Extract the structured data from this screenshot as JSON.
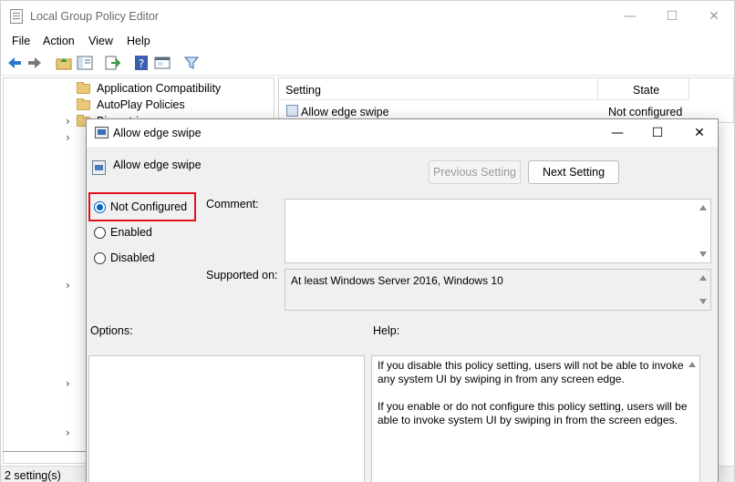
{
  "main_window": {
    "title": "Local Group Policy Editor",
    "controls": {
      "minimize": "—",
      "maximize": "☐",
      "close": "✕"
    }
  },
  "menu": [
    "File",
    "Action",
    "View",
    "Help"
  ],
  "toolbar": {
    "icons": [
      "back-arrow-icon",
      "forward-arrow-icon",
      "folder-up-icon",
      "show-hide-tree-icon",
      "export-list-icon",
      "help-icon",
      "properties-icon",
      "filter-icon"
    ]
  },
  "tree": {
    "items": [
      "Application Compatibility",
      "AutoPlay Policies",
      "Biometrics"
    ]
  },
  "list": {
    "columns": [
      "Setting",
      "State"
    ],
    "rows": [
      {
        "setting": "Allow edge swipe",
        "state": "Not configured"
      }
    ]
  },
  "status": "2 setting(s)",
  "dialog": {
    "title": "Allow edge swipe",
    "policy_name": "Allow edge swipe",
    "prev_button": "Previous Setting",
    "next_button": "Next Setting",
    "options": [
      {
        "label": "Not Configured",
        "checked": true
      },
      {
        "label": "Enabled",
        "checked": false
      },
      {
        "label": "Disabled",
        "checked": false
      }
    ],
    "comment_label": "Comment:",
    "comment_value": "",
    "supported_label": "Supported on:",
    "supported_value": "At least Windows Server 2016, Windows 10",
    "options_label": "Options:",
    "help_label": "Help:",
    "help_paragraphs": [
      "If you disable this policy setting, users will not be able to invoke any system UI by swiping in from any screen edge.",
      "If you enable or do not configure this policy setting, users will be able to invoke system UI by swiping in from the screen edges."
    ],
    "highlight_color": "#e0121b",
    "accent_color": "#0067c0"
  }
}
